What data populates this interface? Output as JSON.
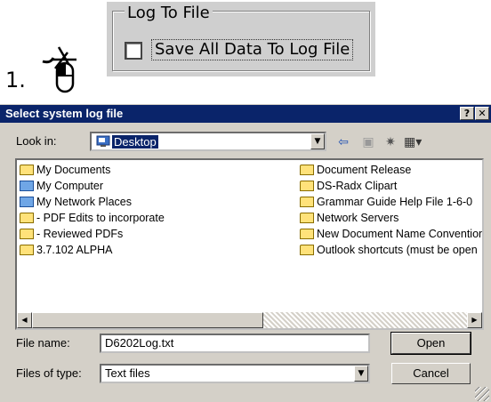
{
  "step": {
    "number": "1."
  },
  "log_group": {
    "label": "Log To File",
    "checkbox_label": "Save All Data To Log File",
    "checked": false
  },
  "dialog": {
    "title": "Select system log file",
    "help_label": "?",
    "close_label": "✕",
    "look_in": {
      "label": "Look in:",
      "value": "Desktop"
    },
    "toolbar_icons": [
      "back-arrow-icon",
      "up-folder-icon",
      "new-folder-icon",
      "views-menu-icon"
    ],
    "files_left": [
      {
        "name": "My Documents",
        "icon": "my-documents-icon"
      },
      {
        "name": "My Computer",
        "icon": "my-computer-icon"
      },
      {
        "name": "My Network Places",
        "icon": "network-places-icon"
      },
      {
        "name": "- PDF Edits to incorporate",
        "icon": "folder-icon"
      },
      {
        "name": "- Reviewed PDFs",
        "icon": "folder-icon"
      },
      {
        "name": "3.7.102 ALPHA",
        "icon": "folder-icon"
      }
    ],
    "files_right": [
      {
        "name": "Document Release",
        "icon": "folder-icon"
      },
      {
        "name": "DS-Radx Clipart",
        "icon": "folder-icon"
      },
      {
        "name": "Grammar Guide Help File 1-6-0",
        "icon": "folder-icon"
      },
      {
        "name": "Network Servers",
        "icon": "folder-icon"
      },
      {
        "name": "New Document Name Convention",
        "icon": "folder-icon"
      },
      {
        "name": "Outlook shortcuts (must be open",
        "icon": "folder-icon"
      }
    ],
    "file_name": {
      "label": "File name:",
      "value": "D6202Log.txt"
    },
    "file_type": {
      "label": "Files of type:",
      "value": "Text files"
    },
    "open_label": "Open",
    "cancel_label": "Cancel"
  },
  "colors": {
    "titlebar": "#0a246a",
    "dialog_face": "#d4d0c8",
    "selection": "#0a246a"
  }
}
